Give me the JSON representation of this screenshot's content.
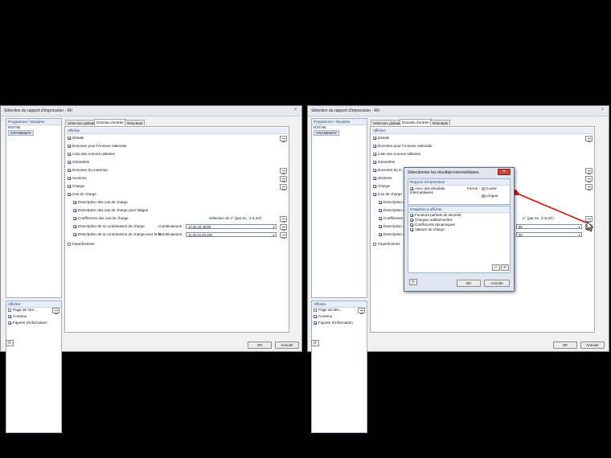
{
  "dialog_title": "Sélection du rapport d'impression - RII",
  "close_glyph": "×",
  "programs_header": "Programme / Modules",
  "programs": [
    "RSTAB",
    "CRANEWAY"
  ],
  "display_header": "Afficher",
  "display_items": [
    {
      "label": "Page de titre...",
      "checked": false
    },
    {
      "label": "Contenu",
      "checked": true
    },
    {
      "label": "Figures d'information",
      "checked": true
    }
  ],
  "tabs": [
    "Sélection globale",
    "Donnée d'entrée",
    "Résultats"
  ],
  "afficher_header": "Afficher",
  "items": {
    "details": "Détails",
    "annexe": "Données pour l'Annexe nationale",
    "liste_noms": "Liste des normes utilisées",
    "geometrie": "Géométrie",
    "donnees_materiau": "Données du matériau",
    "sections": "Sections",
    "charge": "Charge",
    "cas_charge": "Cas de charge",
    "desc_cas": "Description des cas de charge",
    "desc_fatigue": "Description des cas de charge pour fatigue",
    "coefficients": "Coefficients des cas de charge",
    "desc_comb": "Description de la combinaison de charge",
    "desc_comb_fat": "Description de la combinaison de charge pour la fa",
    "imperfections": "Imperfections"
  },
  "selection_hint": "Sélection de n° (par ex. '1-5,20')",
  "combinaisons_label": "Combinaisons :",
  "comb_value_1": "10,25,33,48,89",
  "comb_value_2": "11,26,34,49,100",
  "ok_label": "OK",
  "cancel_label": "Annuler",
  "intermediate_dialog": {
    "title": "Sélectionner les résultats intermédiaires",
    "rapport_header": "Rapport d'impression",
    "avec_resultats": "Avec des résultats intermédiaires",
    "forme_label": "Forme :",
    "courte": "Courte",
    "longue": "Longue",
    "chapitres_header": "Chapitres à afficher",
    "chapitres": [
      "Facteurs partiels de sécurité",
      "Charges additionnelles",
      "Coefficients dynamiques",
      "Valeurs de charge"
    ],
    "close_glyph": "×",
    "ok_label": "OK",
    "cancel_label": "Annuler"
  },
  "partial_right": {
    "desc_cas": "Description d",
    "desc_fatigue": "Description d",
    "coefficients": "Coefficients d",
    "desc_comb": "Description d",
    "desc_comb_fat": "Description d",
    "donnees_materiau": "Données du m",
    "hint_tail": "n° (par ex. '1-5,20')",
    "comb_tail_1": "89",
    "comb_tail_2": "00"
  },
  "arrow_color": "#cc1111"
}
